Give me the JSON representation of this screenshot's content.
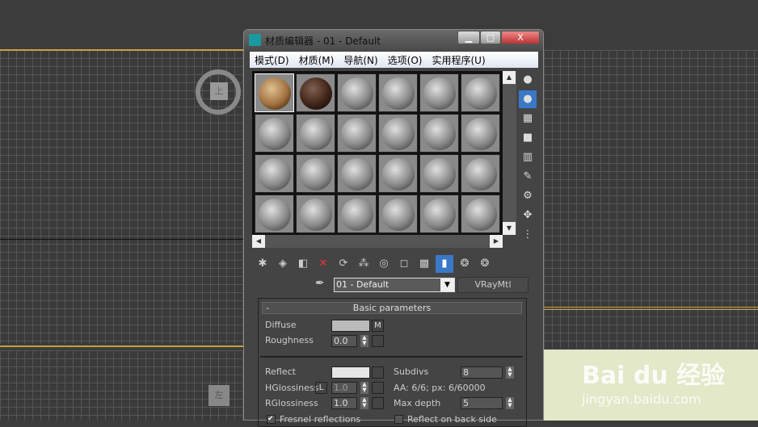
{
  "window": {
    "title": "材质编辑器 - 01 - Default",
    "minimize": "▁",
    "maximize": "□",
    "close": "X"
  },
  "menu": [
    "模式(D)",
    "材质(M)",
    "导航(N)",
    "选项(O)",
    "实用程序(U)"
  ],
  "viewports": {
    "top_label": "上",
    "left_label": "左"
  },
  "material": {
    "name": "01 - Default",
    "type": "VRayMtl"
  },
  "rollout": {
    "title": "Basic parameters",
    "collapse": "-",
    "diffuse": "Diffuse",
    "diffuse_map": "M",
    "roughness": "Roughness",
    "roughness_value": "0.0",
    "reflect": "Reflect",
    "hglossiness": "HGlossiness",
    "lock": "L",
    "hglossiness_value": "1.0",
    "rglossiness": "RGlossiness",
    "rglossiness_value": "1.0",
    "subdivs": "Subdivs",
    "subdivs_value": "8",
    "aa": "AA: 6/6; px: 6/60000",
    "max_depth": "Max depth",
    "max_depth_value": "5",
    "fresnel": "Fresnel reflections",
    "backside": "Reflect on back side"
  },
  "watermark": {
    "brand": "Bai du 经验",
    "url": "jingyan.baidu.com"
  },
  "colors": {
    "accent": "#3a78c8",
    "viewport_border": "#c8a040"
  }
}
